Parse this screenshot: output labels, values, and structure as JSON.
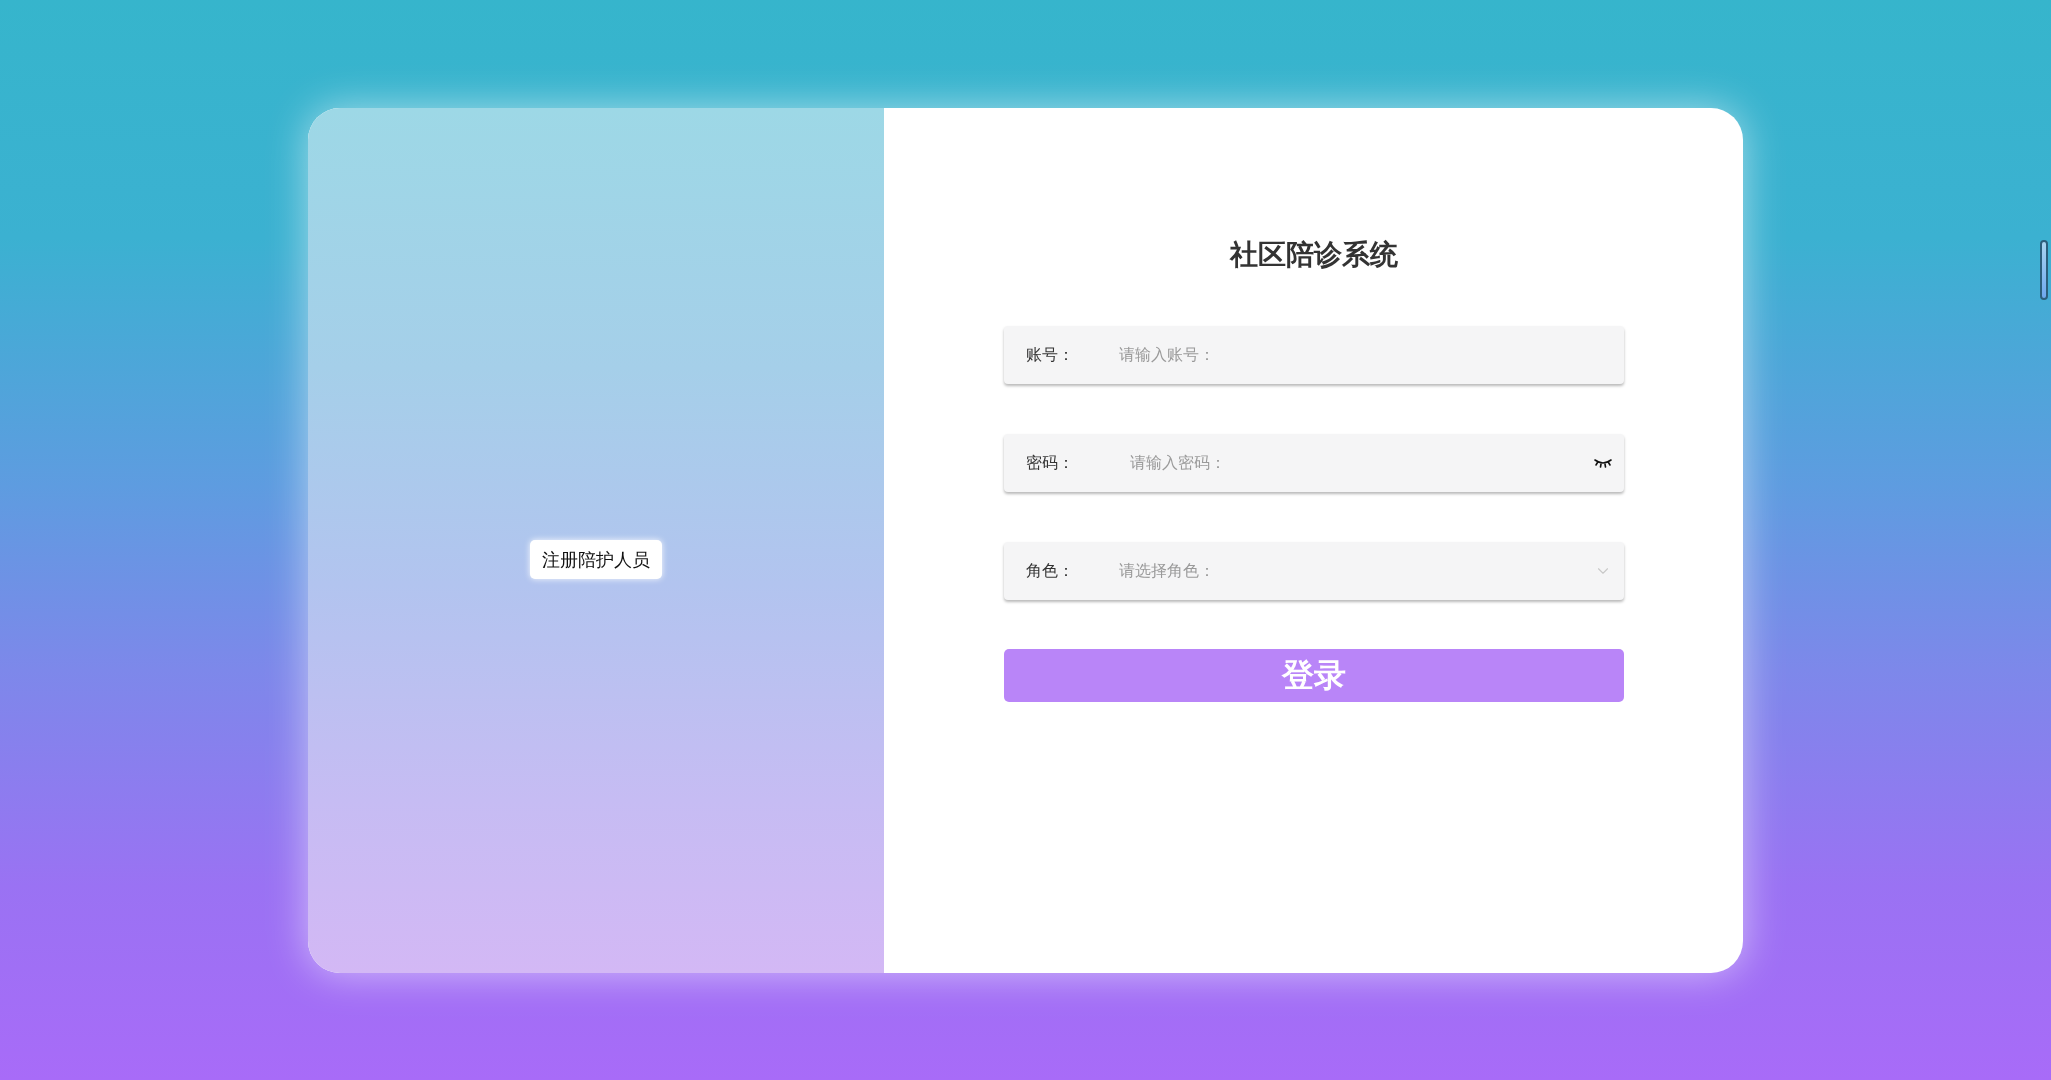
{
  "register_button": "注册陪护人员",
  "title": "社区陪诊系统",
  "fields": [
    {
      "kind": "text",
      "label": "账号：",
      "placeholder": "请输入账号："
    },
    {
      "kind": "password",
      "label": "密码：",
      "placeholder": "请输入密码："
    },
    {
      "kind": "select",
      "label": "角色：",
      "placeholder": "请选择角色："
    }
  ],
  "login_button": "登录"
}
